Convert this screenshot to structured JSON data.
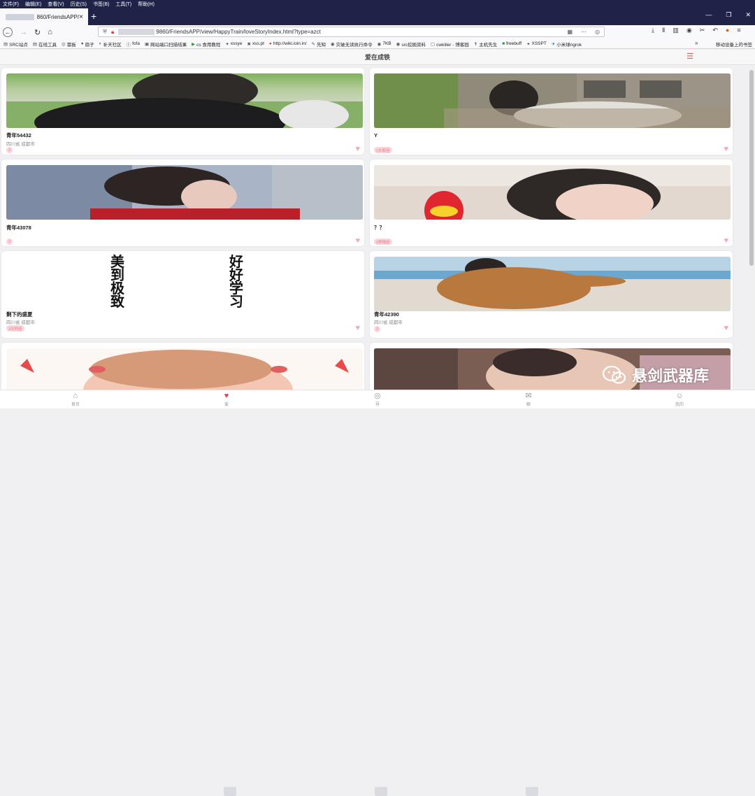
{
  "browser": {
    "menu": [
      "文件(F)",
      "编辑(E)",
      "查看(V)",
      "历史(S)",
      "书签(B)",
      "工具(T)",
      "帮助(H)"
    ],
    "tab_title": "860/FriendsAPP/",
    "tab_close": "×",
    "new_tab": "+",
    "url": "9860/FriendsAPP/view/HappyTrain/loveStoryIndex.html?type=azct",
    "bookmarks": [
      "SRC站点",
      "在线工具",
      "需板",
      "扇子",
      "补天社区",
      "fofa",
      "网站端口扫描结果",
      "cs 食用教程",
      "xssye",
      "xss.pt",
      "http://wiki.ioin.in/",
      "先知",
      "灾破无读执行命令",
      "7KB",
      "src挖掘资料",
      "cwkiller - 博客园",
      "主机先生",
      "freebuff",
      "XSSPT",
      "小米球ngrok"
    ],
    "bookmarks_right": "移动设备上的书签"
  },
  "app": {
    "title": "爱在成铁",
    "cards": [
      {
        "title": "青年54432",
        "location": "四川省 成都市",
        "tag": "2"
      },
      {
        "title": "Y",
        "location": "",
        "tag": "2水瓶座"
      },
      {
        "title": "青年43078",
        "location": "",
        "tag": "2"
      },
      {
        "title": "？？",
        "location": "",
        "tag": "2摩羯座"
      },
      {
        "title": "剩下的盛夏",
        "location": "四川省 成都市",
        "tag": "2天秤座",
        "poster": [
          "美",
          "到",
          "极",
          "致",
          "好",
          "好",
          "学",
          "习"
        ]
      },
      {
        "title": "青年42390",
        "location": "四川省 成都市",
        "tag": "2"
      }
    ],
    "tabs": [
      "首页",
      "爱",
      "导",
      "解",
      "我的"
    ]
  },
  "watermark": "悬剑武器库",
  "colors": {
    "accent": "#e84050",
    "tag_bg": "#fbd5dc",
    "browser_dark": "#1f2347"
  }
}
